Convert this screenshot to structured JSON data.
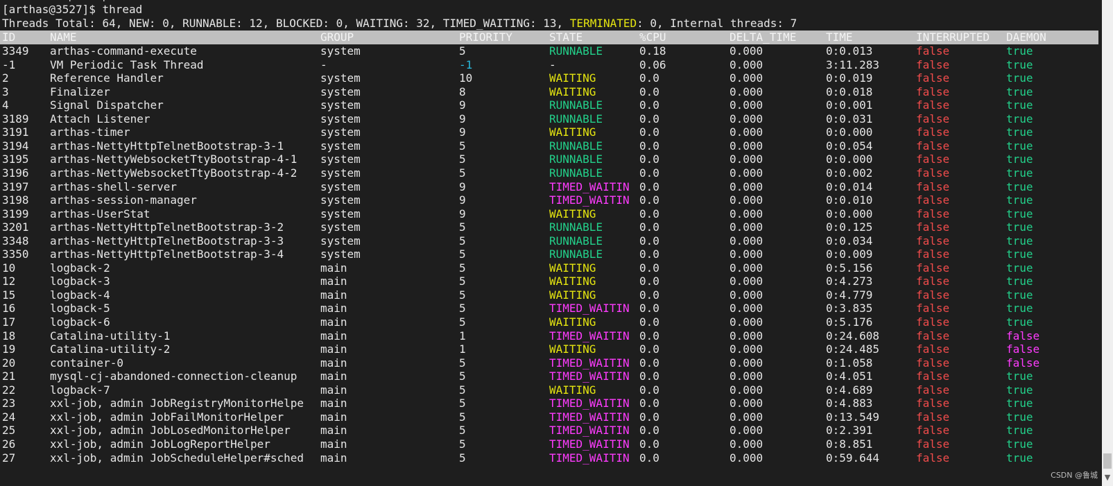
{
  "terminal": {
    "cut_line": "          [    ]                                                                                           ",
    "prompt": "[arthas@3527]$ thread",
    "summary": {
      "prefix": "Threads Total: 64, NEW: 0, RUNNABLE: 12, BLOCKED: 0, WAITING: 32, TIMED_WAITING: 13, ",
      "terminated_label": "TERMINATED",
      "suffix": ": 0, Internal threads: 7"
    },
    "columns": [
      "ID",
      "NAME",
      "GROUP",
      "PRIORITY",
      "STATE",
      "%CPU",
      "DELTA_TIME",
      "TIME",
      "INTERRUPTED",
      "DAEMON"
    ],
    "rows": [
      {
        "id": "3349",
        "name": "arthas-command-execute",
        "group": "system",
        "priority": "5",
        "state": "RUNNABLE",
        "cpu": "0.18",
        "delta": "0.000",
        "time": "0:0.013",
        "interrupted": "false",
        "daemon": "true"
      },
      {
        "id": "-1",
        "name": "VM Periodic Task Thread",
        "group": "-",
        "priority": "-1",
        "state": "-",
        "cpu": "0.06",
        "delta": "0.000",
        "time": "3:11.283",
        "interrupted": "false",
        "daemon": "true"
      },
      {
        "id": "2",
        "name": "Reference Handler",
        "group": "system",
        "priority": "10",
        "state": "WAITING",
        "cpu": "0.0",
        "delta": "0.000",
        "time": "0:0.019",
        "interrupted": "false",
        "daemon": "true"
      },
      {
        "id": "3",
        "name": "Finalizer",
        "group": "system",
        "priority": "8",
        "state": "WAITING",
        "cpu": "0.0",
        "delta": "0.000",
        "time": "0:0.018",
        "interrupted": "false",
        "daemon": "true"
      },
      {
        "id": "4",
        "name": "Signal Dispatcher",
        "group": "system",
        "priority": "9",
        "state": "RUNNABLE",
        "cpu": "0.0",
        "delta": "0.000",
        "time": "0:0.001",
        "interrupted": "false",
        "daemon": "true"
      },
      {
        "id": "3189",
        "name": "Attach Listener",
        "group": "system",
        "priority": "9",
        "state": "RUNNABLE",
        "cpu": "0.0",
        "delta": "0.000",
        "time": "0:0.031",
        "interrupted": "false",
        "daemon": "true"
      },
      {
        "id": "3191",
        "name": "arthas-timer",
        "group": "system",
        "priority": "9",
        "state": "WAITING",
        "cpu": "0.0",
        "delta": "0.000",
        "time": "0:0.000",
        "interrupted": "false",
        "daemon": "true"
      },
      {
        "id": "3194",
        "name": "arthas-NettyHttpTelnetBootstrap-3-1",
        "group": "system",
        "priority": "5",
        "state": "RUNNABLE",
        "cpu": "0.0",
        "delta": "0.000",
        "time": "0:0.054",
        "interrupted": "false",
        "daemon": "true"
      },
      {
        "id": "3195",
        "name": "arthas-NettyWebsocketTtyBootstrap-4-1",
        "group": "system",
        "priority": "5",
        "state": "RUNNABLE",
        "cpu": "0.0",
        "delta": "0.000",
        "time": "0:0.000",
        "interrupted": "false",
        "daemon": "true"
      },
      {
        "id": "3196",
        "name": "arthas-NettyWebsocketTtyBootstrap-4-2",
        "group": "system",
        "priority": "5",
        "state": "RUNNABLE",
        "cpu": "0.0",
        "delta": "0.000",
        "time": "0:0.002",
        "interrupted": "false",
        "daemon": "true"
      },
      {
        "id": "3197",
        "name": "arthas-shell-server",
        "group": "system",
        "priority": "9",
        "state": "TIMED_WAITIN",
        "cpu": "0.0",
        "delta": "0.000",
        "time": "0:0.014",
        "interrupted": "false",
        "daemon": "true"
      },
      {
        "id": "3198",
        "name": "arthas-session-manager",
        "group": "system",
        "priority": "9",
        "state": "TIMED_WAITIN",
        "cpu": "0.0",
        "delta": "0.000",
        "time": "0:0.010",
        "interrupted": "false",
        "daemon": "true"
      },
      {
        "id": "3199",
        "name": "arthas-UserStat",
        "group": "system",
        "priority": "9",
        "state": "WAITING",
        "cpu": "0.0",
        "delta": "0.000",
        "time": "0:0.000",
        "interrupted": "false",
        "daemon": "true"
      },
      {
        "id": "3201",
        "name": "arthas-NettyHttpTelnetBootstrap-3-2",
        "group": "system",
        "priority": "5",
        "state": "RUNNABLE",
        "cpu": "0.0",
        "delta": "0.000",
        "time": "0:0.125",
        "interrupted": "false",
        "daemon": "true"
      },
      {
        "id": "3348",
        "name": "arthas-NettyHttpTelnetBootstrap-3-3",
        "group": "system",
        "priority": "5",
        "state": "RUNNABLE",
        "cpu": "0.0",
        "delta": "0.000",
        "time": "0:0.034",
        "interrupted": "false",
        "daemon": "true"
      },
      {
        "id": "3350",
        "name": "arthas-NettyHttpTelnetBootstrap-3-4",
        "group": "system",
        "priority": "5",
        "state": "RUNNABLE",
        "cpu": "0.0",
        "delta": "0.000",
        "time": "0:0.009",
        "interrupted": "false",
        "daemon": "true"
      },
      {
        "id": "10",
        "name": "logback-2",
        "group": "main",
        "priority": "5",
        "state": "WAITING",
        "cpu": "0.0",
        "delta": "0.000",
        "time": "0:5.156",
        "interrupted": "false",
        "daemon": "true"
      },
      {
        "id": "12",
        "name": "logback-3",
        "group": "main",
        "priority": "5",
        "state": "WAITING",
        "cpu": "0.0",
        "delta": "0.000",
        "time": "0:4.273",
        "interrupted": "false",
        "daemon": "true"
      },
      {
        "id": "15",
        "name": "logback-4",
        "group": "main",
        "priority": "5",
        "state": "WAITING",
        "cpu": "0.0",
        "delta": "0.000",
        "time": "0:4.779",
        "interrupted": "false",
        "daemon": "true"
      },
      {
        "id": "16",
        "name": "logback-5",
        "group": "main",
        "priority": "5",
        "state": "TIMED_WAITIN",
        "cpu": "0.0",
        "delta": "0.000",
        "time": "0:3.835",
        "interrupted": "false",
        "daemon": "true"
      },
      {
        "id": "17",
        "name": "logback-6",
        "group": "main",
        "priority": "5",
        "state": "WAITING",
        "cpu": "0.0",
        "delta": "0.000",
        "time": "0:5.176",
        "interrupted": "false",
        "daemon": "true"
      },
      {
        "id": "18",
        "name": "Catalina-utility-1",
        "group": "main",
        "priority": "1",
        "state": "TIMED_WAITIN",
        "cpu": "0.0",
        "delta": "0.000",
        "time": "0:24.608",
        "interrupted": "false",
        "daemon": "false"
      },
      {
        "id": "19",
        "name": "Catalina-utility-2",
        "group": "main",
        "priority": "1",
        "state": "WAITING",
        "cpu": "0.0",
        "delta": "0.000",
        "time": "0:24.485",
        "interrupted": "false",
        "daemon": "false"
      },
      {
        "id": "20",
        "name": "container-0",
        "group": "main",
        "priority": "5",
        "state": "TIMED_WAITIN",
        "cpu": "0.0",
        "delta": "0.000",
        "time": "0:1.058",
        "interrupted": "false",
        "daemon": "false"
      },
      {
        "id": "21",
        "name": "mysql-cj-abandoned-connection-cleanup",
        "group": "main",
        "priority": "5",
        "state": "TIMED_WAITIN",
        "cpu": "0.0",
        "delta": "0.000",
        "time": "0:4.051",
        "interrupted": "false",
        "daemon": "true"
      },
      {
        "id": "22",
        "name": "logback-7",
        "group": "main",
        "priority": "5",
        "state": "WAITING",
        "cpu": "0.0",
        "delta": "0.000",
        "time": "0:4.689",
        "interrupted": "false",
        "daemon": "true"
      },
      {
        "id": "23",
        "name": "xxl-job, admin JobRegistryMonitorHelpe",
        "group": "main",
        "priority": "5",
        "state": "TIMED_WAITIN",
        "cpu": "0.0",
        "delta": "0.000",
        "time": "0:4.883",
        "interrupted": "false",
        "daemon": "true"
      },
      {
        "id": "24",
        "name": "xxl-job, admin JobFailMonitorHelper",
        "group": "main",
        "priority": "5",
        "state": "TIMED_WAITIN",
        "cpu": "0.0",
        "delta": "0.000",
        "time": "0:13.549",
        "interrupted": "false",
        "daemon": "true"
      },
      {
        "id": "25",
        "name": "xxl-job, admin JobLosedMonitorHelper",
        "group": "main",
        "priority": "5",
        "state": "TIMED_WAITIN",
        "cpu": "0.0",
        "delta": "0.000",
        "time": "0:2.391",
        "interrupted": "false",
        "daemon": "true"
      },
      {
        "id": "26",
        "name": "xxl-job, admin JobLogReportHelper",
        "group": "main",
        "priority": "5",
        "state": "TIMED_WAITIN",
        "cpu": "0.0",
        "delta": "0.000",
        "time": "0:8.851",
        "interrupted": "false",
        "daemon": "true"
      },
      {
        "id": "27",
        "name": "xxl-job, admin JobScheduleHelper#sched",
        "group": "main",
        "priority": "5",
        "state": "TIMED_WAITIN",
        "cpu": "0.0",
        "delta": "0.000",
        "time": "0:59.644",
        "interrupted": "false",
        "daemon": "true"
      }
    ],
    "watermark": "CSDN @鲁城"
  },
  "colors": {
    "background": "#1e1e1e",
    "foreground": "#e6e6e6",
    "header_bar": "#c0c0c0",
    "yellow": "#e5e510",
    "green": "#23d18b",
    "cyan": "#29b8db",
    "magenta": "#ff3cff",
    "red": "#f14c4c",
    "white": "#e6e6e6"
  },
  "scrollbar": {
    "down_arrow_icon": "chevron-down-icon"
  }
}
